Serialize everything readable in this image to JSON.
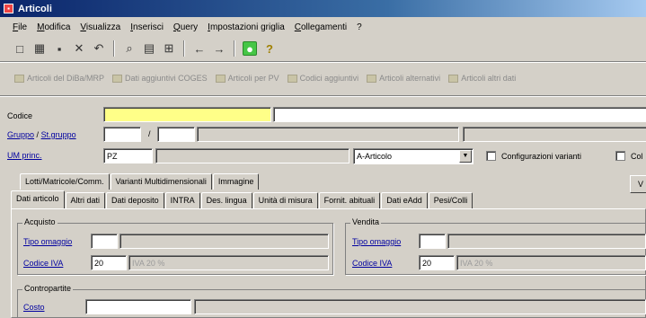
{
  "window": {
    "title": "Articoli",
    "app_icon": "app-icon"
  },
  "menu": [
    "File",
    "Modifica",
    "Visualizza",
    "Inserisci",
    "Query",
    "Impostazioni griglia",
    "Collegamenti",
    "?"
  ],
  "toolbar": {
    "icons": [
      "new-icon",
      "save-all-icon",
      "save-icon",
      "delete-icon",
      "undo-icon",
      "find-icon",
      "list-icon",
      "filter-icon",
      "back-icon",
      "forward-icon",
      "refresh-icon",
      "help-icon"
    ],
    "glyphs": [
      "□",
      "▦",
      "▪",
      "✕",
      "↶",
      "⌕",
      "▤",
      "⊞",
      "←",
      "→",
      "●",
      "?"
    ]
  },
  "linkbar": [
    "Articoli del DiBa/MRP",
    "Dati aggiuntivi COGES",
    "Articoli per PV",
    "Codici aggiuntivi",
    "Articoli alternativi",
    "Articoli altri dati"
  ],
  "form": {
    "codice_label": "Codice",
    "codice_value": "",
    "gruppo_label": "Gruppo",
    "slash": "/",
    "stgruppo_label": "St.gruppo",
    "um_label": "UM princ.",
    "um_value": "PZ",
    "tipo_select": "A-Articolo",
    "check_config": "Configurazioni varianti",
    "check_col": "Col",
    "btn_v": "V"
  },
  "tabs_top": [
    "Lotti/Matricole/Comm.",
    "Varianti Multidimensionali",
    "Immagine"
  ],
  "tabs_main": [
    "Dati articolo",
    "Altri dati",
    "Dati deposito",
    "INTRA",
    "Des. lingua",
    "Unità di misura",
    "Fornit. abituali",
    "Dati eAdd",
    "Pesi/Colli"
  ],
  "acquisto": {
    "title": "Acquisto",
    "tipo_omaggio_label": "Tipo omaggio",
    "codice_iva_label": "Codice IVA",
    "codice_iva_value": "20",
    "iva_desc": "IVA 20 %"
  },
  "vendita": {
    "title": "Vendita",
    "tipo_omaggio_label": "Tipo omaggio",
    "codice_iva_label": "Codice IVA",
    "codice_iva_value": "20",
    "iva_desc": "IVA 20 %"
  },
  "contropartite": {
    "title": "Contropartite",
    "costo_label": "Costo"
  }
}
